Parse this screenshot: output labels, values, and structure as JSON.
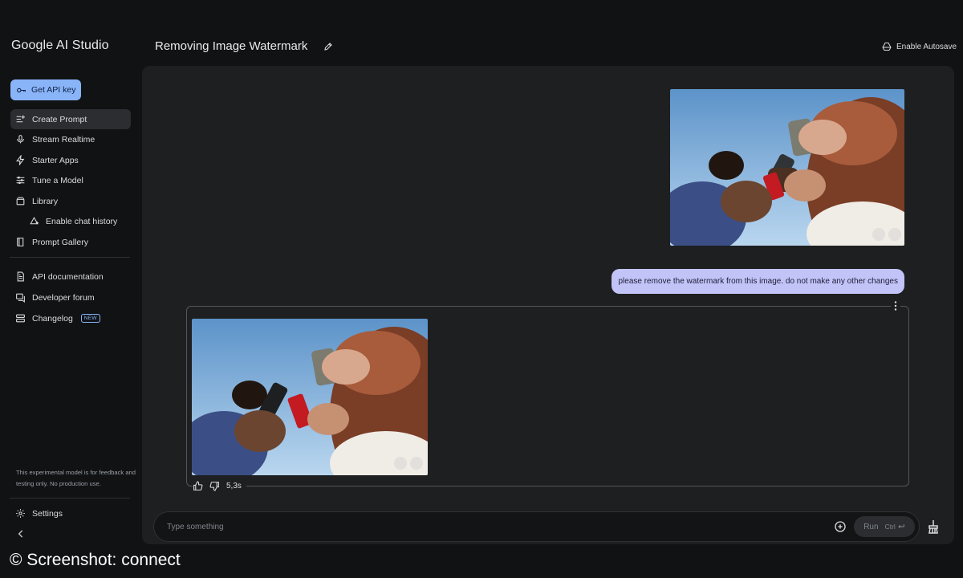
{
  "app": {
    "brand": "Google AI Studio",
    "get_api_key_label": "Get API key",
    "colors": {
      "accent": "#8ab4f8",
      "user_bubble": "#c2c4f8",
      "background": "#101214",
      "panel": "#1e1f21"
    }
  },
  "header": {
    "title": "Removing Image Watermark",
    "edit_icon": "pencil-icon",
    "autosave_label": "Enable Autosave",
    "autosave_icon": "drive-icon"
  },
  "sidebar": {
    "items": [
      {
        "label": "Create Prompt",
        "icon": "create-prompt-icon",
        "active": true
      },
      {
        "label": "Stream Realtime",
        "icon": "microphone-icon"
      },
      {
        "label": "Starter Apps",
        "icon": "bolt-icon"
      },
      {
        "label": "Tune a Model",
        "icon": "sliders-icon"
      },
      {
        "label": "Library",
        "icon": "library-icon"
      },
      {
        "label": "Enable chat history",
        "icon": "history-icon",
        "indent": true
      },
      {
        "label": "Prompt Gallery",
        "icon": "book-icon"
      }
    ],
    "resources": [
      {
        "label": "API documentation",
        "icon": "doc-icon"
      },
      {
        "label": "Developer forum",
        "icon": "forum-icon"
      },
      {
        "label": "Changelog",
        "icon": "changelog-icon",
        "badge": "NEW"
      }
    ],
    "disclaimer": "This experimental model is for feedback and testing only. No production use.",
    "settings_label": "Settings",
    "collapse_icon": "chevron-left-icon"
  },
  "chat": {
    "user_message": "please remove the watermark from this image. do not make any other changes",
    "response_time": "5,3s"
  },
  "composer": {
    "placeholder": "Type something",
    "run_label": "Run",
    "shortcut": "Ctrl"
  },
  "credit": "© Screenshot: connect"
}
